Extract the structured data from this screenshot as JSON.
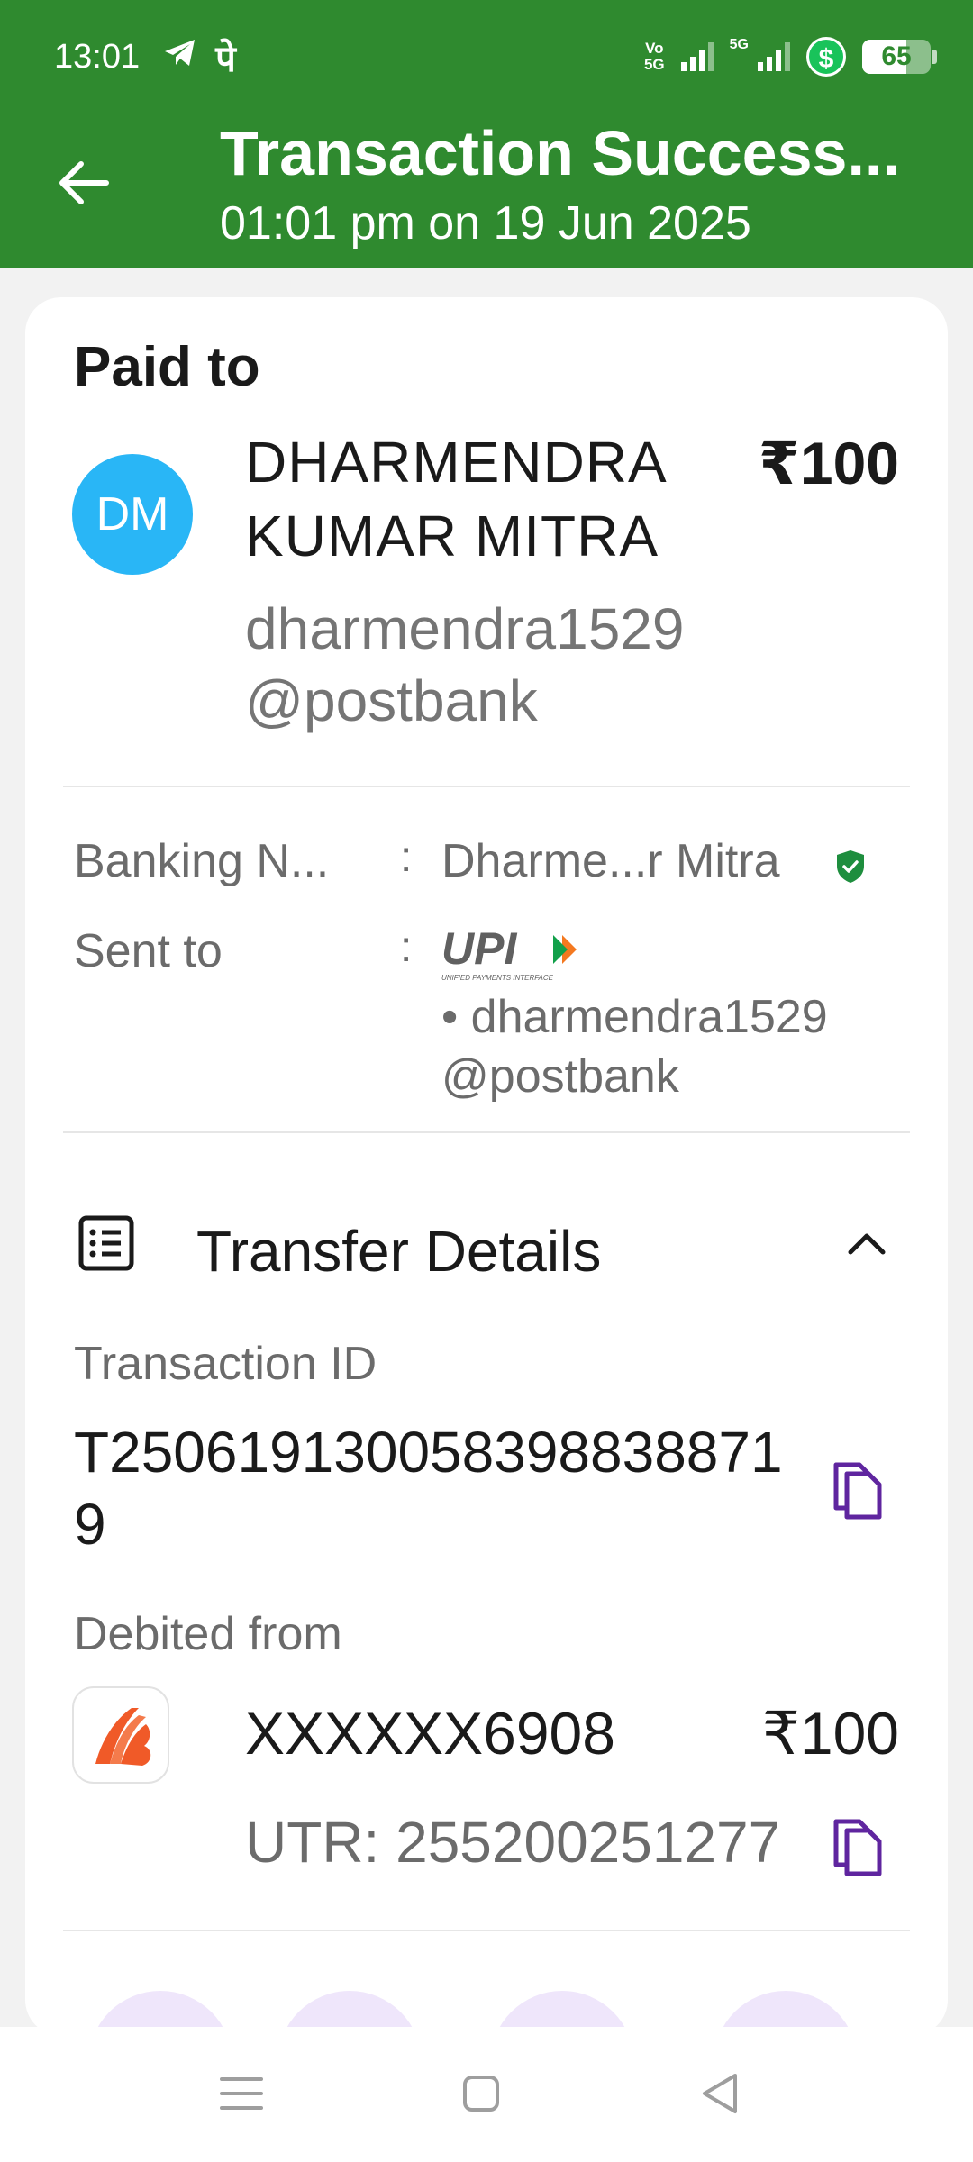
{
  "status_bar": {
    "time": "13:01",
    "telegram_icon": "telegram-icon",
    "pe_glyph": "पे",
    "volte_top": "Vo",
    "volte_bottom": "5G",
    "net_label": "5G",
    "battery": "65",
    "battery_level": 0.65
  },
  "header": {
    "title": "Transaction Success...",
    "subtitle": "01:01 pm on 19 Jun 2025",
    "colors": {
      "background": "#2f8a2f"
    }
  },
  "paid": {
    "heading": "Paid to",
    "avatar_initials": "DM",
    "payee_name": "DHARMENDRA KUMAR MITRA",
    "amount": "₹100",
    "vpa": "dharmendra1529 @postbank"
  },
  "details": {
    "banking_name_label": "Banking N...",
    "banking_name_value": "Dharme...r Mitra",
    "sent_to_label": "Sent to",
    "sent_to_vpa": "• dharmendra1529 @postbank",
    "upi_logo_text": "UPI",
    "upi_logo_sub": "UNIFIED PAYMENTS INTERFACE",
    "colon": ":"
  },
  "transfer": {
    "title": "Transfer Details",
    "txn_label": "Transaction ID",
    "txn_id": "T2506191300583988388719",
    "debited_label": "Debited from",
    "account": "XXXXXX6908",
    "amount": "₹100",
    "utr": "UTR: 255200251277"
  },
  "colors": {
    "accent": "#5f259f",
    "avatar": "#29b6f6",
    "verified": "#1e8e3e"
  }
}
